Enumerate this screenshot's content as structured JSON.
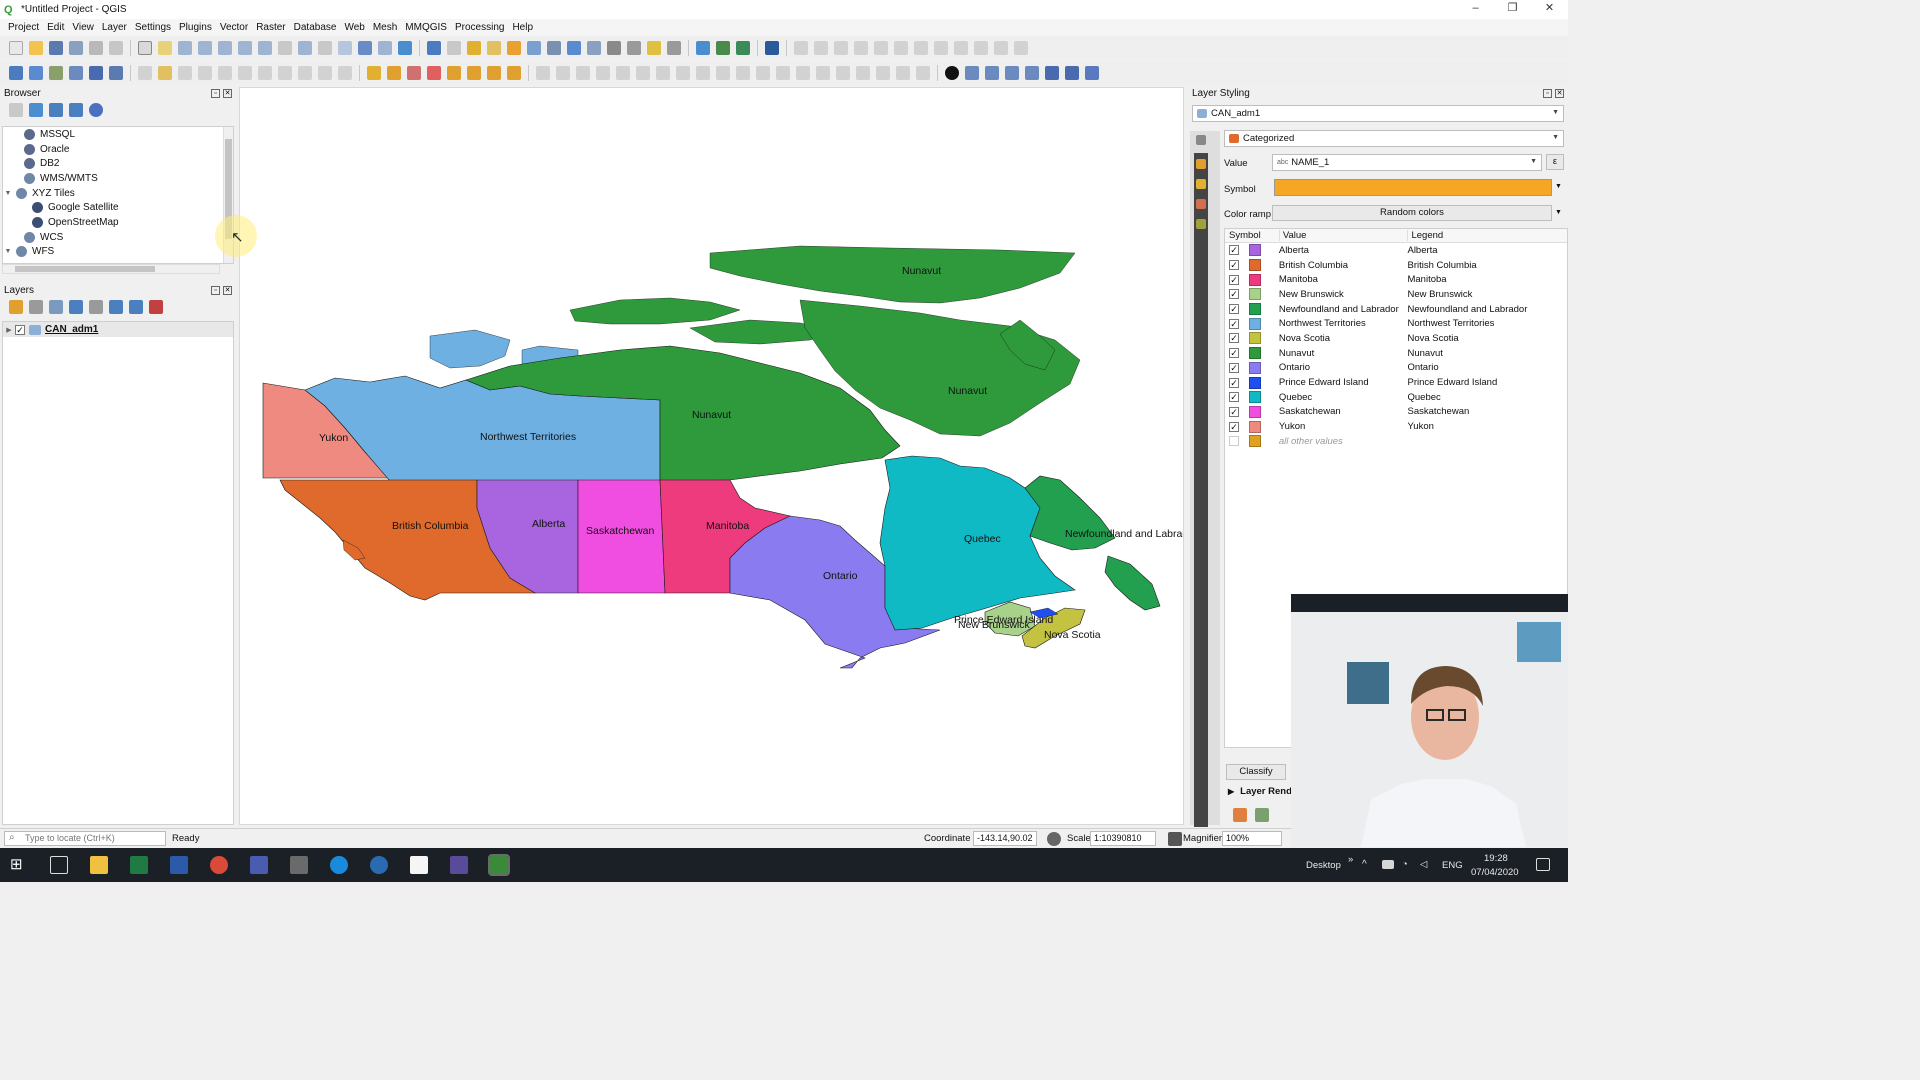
{
  "window": {
    "title": "*Untitled Project - QGIS",
    "controls": [
      "–",
      "❐",
      "✕"
    ]
  },
  "menu": [
    "Project",
    "Edit",
    "View",
    "Layer",
    "Settings",
    "Plugins",
    "Vector",
    "Raster",
    "Database",
    "Web",
    "Mesh",
    "MMQGIS",
    "Processing",
    "Help"
  ],
  "browser": {
    "title": "Browser",
    "items": [
      {
        "label": "MSSQL",
        "icon": "mssql-icon",
        "color": "#5b6a8c",
        "indent": 1,
        "expander": ""
      },
      {
        "label": "Oracle",
        "icon": "oracle-icon",
        "color": "#5b6a8c",
        "indent": 1,
        "expander": ""
      },
      {
        "label": "DB2",
        "icon": "db2-icon",
        "color": "#5b6a8c",
        "indent": 1,
        "expander": ""
      },
      {
        "label": "WMS/WMTS",
        "icon": "globe-icon",
        "color": "#6f88a8",
        "indent": 1,
        "expander": ""
      },
      {
        "label": "XYZ Tiles",
        "icon": "globe-icon",
        "color": "#6f88a8",
        "indent": 0,
        "expander": "▼"
      },
      {
        "label": "Google Satellite",
        "icon": "grid-icon",
        "color": "#3b4f73",
        "indent": 2,
        "expander": ""
      },
      {
        "label": "OpenStreetMap",
        "icon": "grid-icon",
        "color": "#3b4f73",
        "indent": 2,
        "expander": ""
      },
      {
        "label": "WCS",
        "icon": "globe-icon",
        "color": "#6f88a8",
        "indent": 1,
        "expander": ""
      },
      {
        "label": "WFS",
        "icon": "globe-icon",
        "color": "#6f88a8",
        "indent": 0,
        "expander": "▼"
      }
    ]
  },
  "layers": {
    "title": "Layers",
    "items": [
      {
        "label": "CAN_adm1",
        "checked": true
      }
    ]
  },
  "map": {
    "labels": {
      "nunavut_1": "Nunavut",
      "nunavut_2": "Nunavut",
      "nunavut_3": "Nunavut",
      "yukon": "Yukon",
      "nwt": "Northwest Territories",
      "bc": "British Columbia",
      "alberta": "Alberta",
      "saskatchewan": "Saskatchewan",
      "manitoba": "Manitoba",
      "ontario": "Ontario",
      "quebec": "Quebec",
      "newfoundland": "Newfoundland and Labrador",
      "pei": "Prince Edward Island",
      "nb": "New Brunswick",
      "ns": "Nova Scotia"
    }
  },
  "styling": {
    "title": "Layer Styling",
    "layer": "CAN_adm1",
    "renderer": "Categorized",
    "value_label": "Value",
    "value_field_prefix": "abc",
    "value_field": "NAME_1",
    "symbol_label": "Symbol",
    "symbol_color": "#f5a623",
    "color_ramp_label": "Color ramp",
    "color_ramp": "Random colors",
    "table_headers": [
      "Symbol",
      "Value",
      "Legend"
    ],
    "categories": [
      {
        "value": "Alberta",
        "legend": "Alberta",
        "color": "#a964e0"
      },
      {
        "value": "British Columbia",
        "legend": "British Columbia",
        "color": "#e06a2c"
      },
      {
        "value": "Manitoba",
        "legend": "Manitoba",
        "color": "#ee3b7e"
      },
      {
        "value": "New Brunswick",
        "legend": "New Brunswick",
        "color": "#a8d18a"
      },
      {
        "value": "Newfoundland and Labrador",
        "legend": "Newfoundland and Labrador",
        "color": "#22a050"
      },
      {
        "value": "Northwest Territories",
        "legend": "Northwest Territories",
        "color": "#6fb0e2"
      },
      {
        "value": "Nova Scotia",
        "legend": "Nova Scotia",
        "color": "#c4c241"
      },
      {
        "value": "Nunavut",
        "legend": "Nunavut",
        "color": "#2e9a3c"
      },
      {
        "value": "Ontario",
        "legend": "Ontario",
        "color": "#8a7cf0"
      },
      {
        "value": "Prince Edward Island",
        "legend": "Prince Edward Island",
        "color": "#1f4ff0"
      },
      {
        "value": "Quebec",
        "legend": "Quebec",
        "color": "#10bac4"
      },
      {
        "value": "Saskatchewan",
        "legend": "Saskatchewan",
        "color": "#f04ee0"
      },
      {
        "value": "Yukon",
        "legend": "Yukon",
        "color": "#ee8a80"
      }
    ],
    "other_values": {
      "label": "all other values",
      "color": "#e0a020"
    },
    "classify_button": "Classify",
    "layer_rendering": "Layer Rend"
  },
  "status": {
    "locate_placeholder": "Type to locate (Ctrl+K)",
    "ready": "Ready",
    "coordinate_label": "Coordinate",
    "coordinate": "-143.14,90.02",
    "scale_label": "Scale",
    "scale": "1:10390810",
    "magnifier_label": "Magnifier",
    "magnifier": "100%"
  },
  "taskbar": {
    "desktop": "Desktop",
    "chevron": "»",
    "lang": "ENG",
    "time": "19:28",
    "date": "07/04/2020"
  }
}
